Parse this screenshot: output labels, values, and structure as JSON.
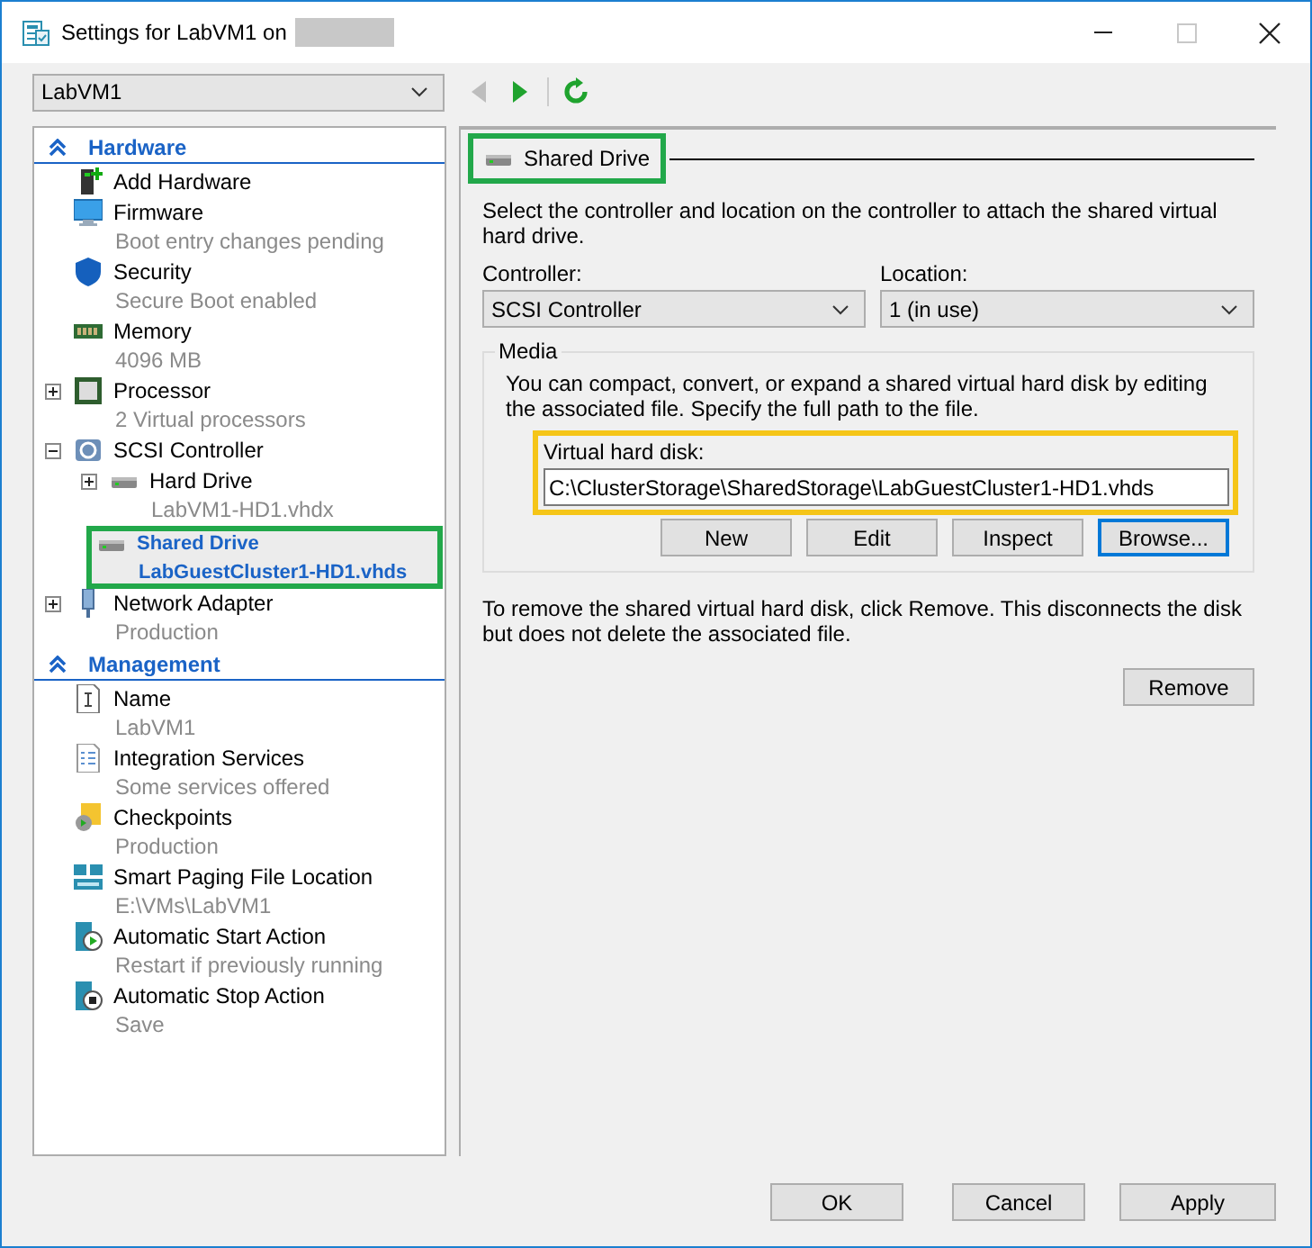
{
  "window": {
    "title": "Settings for LabVM1 on",
    "controls": [
      {
        "kind": "minimize",
        "disabled": false
      },
      {
        "kind": "maximize",
        "disabled": true
      },
      {
        "kind": "close",
        "disabled": false
      }
    ]
  },
  "vm_selector": {
    "value": "LabVM1"
  },
  "toolbar": [
    {
      "kind": "back",
      "disabled": true
    },
    {
      "kind": "forward",
      "disabled": false
    },
    {
      "kind": "refresh",
      "disabled": false
    }
  ],
  "sidebar": {
    "sections": [
      {
        "title": "Hardware",
        "expanded": true,
        "items": [
          {
            "name": "Add Hardware",
            "selected": false
          },
          {
            "name": "Firmware",
            "detail": "Boot entry changes pending",
            "selected": false
          },
          {
            "name": "Security",
            "detail": "Secure Boot enabled",
            "selected": false
          },
          {
            "name": "Memory",
            "detail": "4096 MB",
            "selected": false
          },
          {
            "name": "Processor",
            "detail": "2 Virtual processors",
            "expanded": false,
            "selected": false
          },
          {
            "name": "SCSI Controller",
            "expanded": true,
            "selected": false,
            "children": [
              {
                "name": "Hard Drive",
                "detail": "LabVM1-HD1.vhdx",
                "expanded": false,
                "selected": false
              },
              {
                "name": "Shared Drive",
                "detail": "LabGuestCluster1-HD1.vhds",
                "selected": true,
                "highlighted": true
              }
            ]
          },
          {
            "name": "Network Adapter",
            "detail": "Production",
            "expanded": false,
            "selected": false
          }
        ]
      },
      {
        "title": "Management",
        "expanded": true,
        "items": [
          {
            "name": "Name",
            "detail": "LabVM1",
            "selected": false
          },
          {
            "name": "Integration Services",
            "detail": "Some services offered",
            "selected": false
          },
          {
            "name": "Checkpoints",
            "detail": "Production",
            "selected": false
          },
          {
            "name": "Smart Paging File Location",
            "detail": "E:\\VMs\\LabVM1",
            "selected": false
          },
          {
            "name": "Automatic Start Action",
            "detail": "Restart if previously running",
            "selected": false
          },
          {
            "name": "Automatic Stop Action",
            "detail": "Save",
            "selected": false
          }
        ]
      }
    ]
  },
  "panel": {
    "title": "Shared Drive",
    "highlighted": true,
    "description": "Select the controller and location on the controller to attach the shared virtual hard drive.",
    "controller": {
      "label": "Controller:",
      "value": "SCSI Controller"
    },
    "location": {
      "label": "Location:",
      "value": "1 (in use)"
    },
    "media": {
      "title": "Media",
      "description": "You can compact, convert, or expand a shared virtual hard disk by editing the associated file. Specify the full path to the file.",
      "disk": {
        "label": "Virtual hard disk:",
        "value": "C:\\ClusterStorage\\SharedStorage\\LabGuestCluster1-HD1.vhds",
        "highlighted": true
      },
      "buttons": [
        {
          "label": "New",
          "focused": false
        },
        {
          "label": "Edit",
          "focused": false
        },
        {
          "label": "Inspect",
          "focused": false
        },
        {
          "label": "Browse...",
          "focused": true
        }
      ]
    },
    "remove_note": "To remove the shared virtual hard disk, click Remove. This disconnects the disk but does not delete the associated file.",
    "remove_button": {
      "label": "Remove"
    }
  },
  "buttons": [
    {
      "label": "OK"
    },
    {
      "label": "Cancel"
    },
    {
      "label": "Apply"
    }
  ]
}
